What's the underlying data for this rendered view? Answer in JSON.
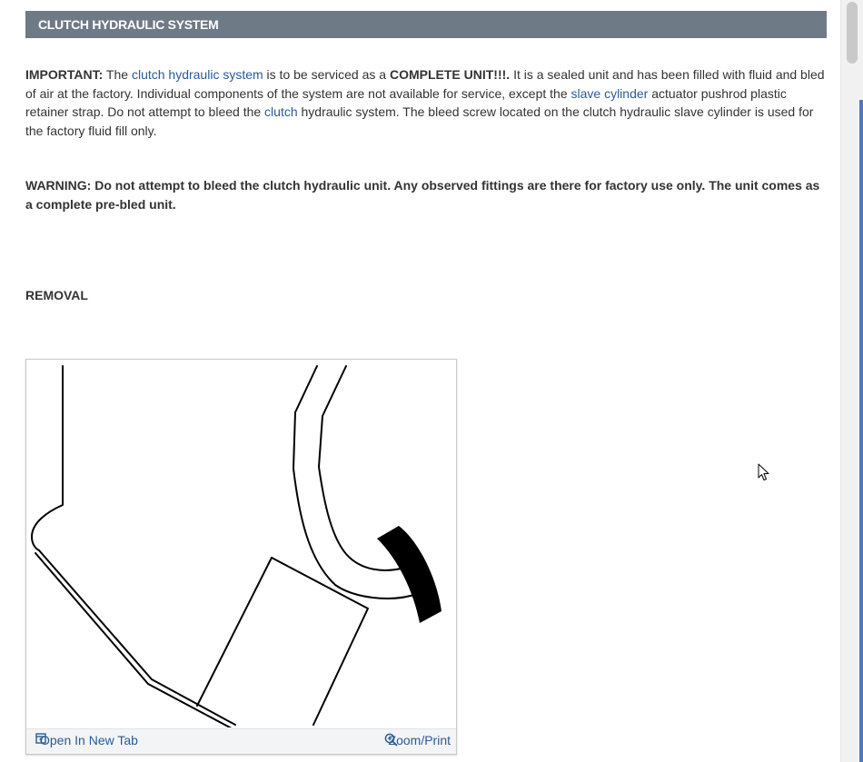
{
  "section": {
    "title": "CLUTCH HYDRAULIC SYSTEM"
  },
  "important": {
    "label": "IMPORTANT:",
    "t1": " The ",
    "link1": "clutch hydraulic system",
    "t2": " is to be serviced as a ",
    "bold1": "COMPLETE UNIT!!!.",
    "t3": " It is a sealed unit and has been filled with fluid and bled of air at the factory. Individual components of the system are not available for service, except the ",
    "link2": "slave cylinder",
    "t4": " actuator pushrod plastic retainer strap. Do not attempt to bleed the ",
    "link3": "clutch",
    "t5": " hydraulic system. The bleed screw located on the clutch hydraulic slave cylinder is used for the factory fluid fill only."
  },
  "warning": {
    "text": "WARNING: Do not attempt to bleed the clutch hydraulic unit. Any observed fittings are there for factory use only. The unit comes as a complete pre-bled unit."
  },
  "removal": {
    "heading": "REMOVAL"
  },
  "figure": {
    "open_label": "Open In New Tab",
    "zoom_label": "Zoom/Print"
  },
  "icons": {
    "open": "open-in-new-tab-icon",
    "zoom": "zoom-in-icon",
    "cursor": "mouse-pointer-icon"
  },
  "colors": {
    "header_bg": "#6f7a87",
    "link": "#2a5b96",
    "text": "#333333"
  }
}
